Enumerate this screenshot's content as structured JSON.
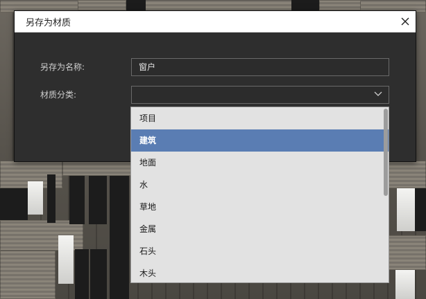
{
  "dialog": {
    "title": "另存为材质",
    "close_glyph": "X"
  },
  "form": {
    "name_label": "另存为名称:",
    "name_value": "窗户",
    "category_label": "材质分类:",
    "category_value": ""
  },
  "dropdown": {
    "items": [
      "项目",
      "建筑",
      "地面",
      "水",
      "草地",
      "金属",
      "石头",
      "木头"
    ],
    "selected_index": 1,
    "selected_color": "#5a7db3"
  },
  "icons": {
    "close": "close-icon",
    "select_arrow": "chevron-down-icon"
  }
}
